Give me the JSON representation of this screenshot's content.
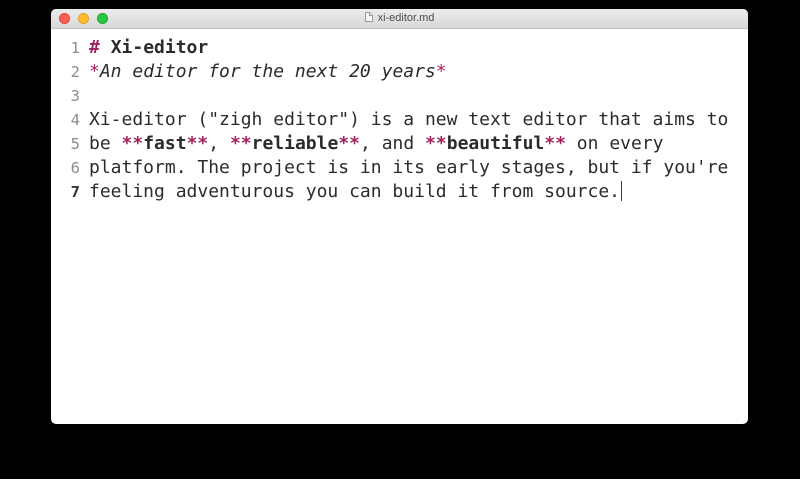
{
  "window": {
    "title": "xi-editor.md",
    "title_icon": "document-icon"
  },
  "colors": {
    "markdown_marker": "#a0215c",
    "text": "#2b2b2b",
    "gutter": "#8c8c8c",
    "close": "#fd5f57",
    "minimize": "#febc2e",
    "maximize": "#28c840"
  },
  "editor": {
    "current_line": 7,
    "lines": [
      {
        "number": "1",
        "segments": [
          {
            "text": "# ",
            "style": "mark"
          },
          {
            "text": "Xi-editor",
            "style": "heading"
          }
        ]
      },
      {
        "number": "2",
        "segments": [
          {
            "text": "*",
            "style": "italic-mark"
          },
          {
            "text": "An editor for the next 20 years",
            "style": "italic"
          },
          {
            "text": "*",
            "style": "italic-mark"
          }
        ]
      },
      {
        "number": "3",
        "segments": []
      },
      {
        "number": "4",
        "segments": [
          {
            "text": "Xi-editor (\"zigh editor\") is a new text editor that aims to",
            "style": "plain"
          }
        ]
      },
      {
        "number": "5",
        "segments": [
          {
            "text": "be ",
            "style": "plain"
          },
          {
            "text": "**",
            "style": "mark"
          },
          {
            "text": "fast",
            "style": "bold"
          },
          {
            "text": "**",
            "style": "mark"
          },
          {
            "text": ", ",
            "style": "plain"
          },
          {
            "text": "**",
            "style": "mark"
          },
          {
            "text": "reliable",
            "style": "bold"
          },
          {
            "text": "**",
            "style": "mark"
          },
          {
            "text": ", and ",
            "style": "plain"
          },
          {
            "text": "**",
            "style": "mark"
          },
          {
            "text": "beautiful",
            "style": "bold"
          },
          {
            "text": "**",
            "style": "mark"
          },
          {
            "text": " on every",
            "style": "plain"
          }
        ]
      },
      {
        "number": "6",
        "segments": [
          {
            "text": "platform. The project is in its early stages, but if you're",
            "style": "plain"
          }
        ]
      },
      {
        "number": "7",
        "segments": [
          {
            "text": "feeling adventurous you can build it from source.",
            "style": "plain"
          }
        ],
        "caret": true
      }
    ]
  }
}
